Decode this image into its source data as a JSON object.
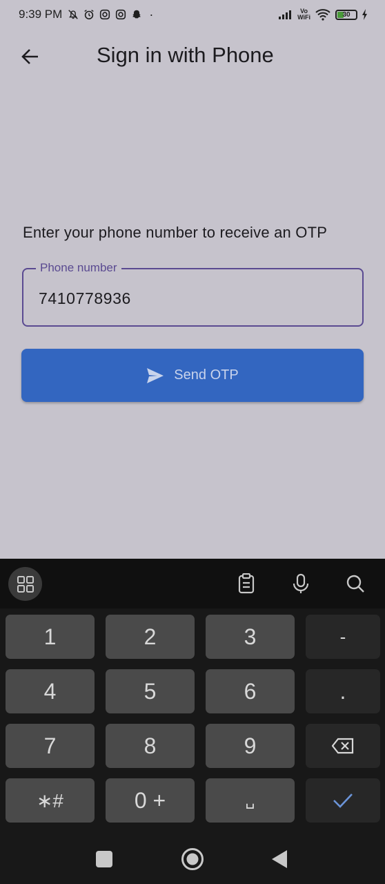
{
  "status_bar": {
    "time": "9:39 PM",
    "network_label_top": "Vo",
    "network_label_bottom": "WiFi",
    "battery_level": "30"
  },
  "app_bar": {
    "title": "Sign in with Phone"
  },
  "form": {
    "prompt": "Enter your phone number to receive an OTP",
    "phone_label": "Phone number",
    "phone_value": "7410778936",
    "send_button_label": "Send OTP"
  },
  "keyboard": {
    "rows": [
      [
        "1",
        "2",
        "3",
        "-"
      ],
      [
        "4",
        "5",
        "6",
        "."
      ],
      [
        "7",
        "8",
        "9",
        ""
      ],
      [
        "∗#",
        "0 +",
        "␣",
        ""
      ]
    ]
  },
  "colors": {
    "background": "#c6c3cc",
    "accent": "#5a4a91",
    "button": "#3366c0",
    "keyboard": "#181818"
  }
}
